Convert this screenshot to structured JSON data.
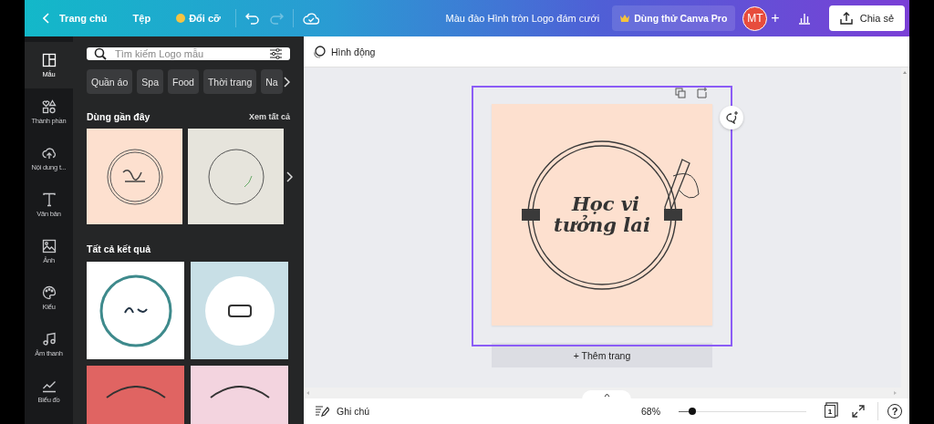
{
  "topbar": {
    "back": "Trang chủ",
    "file": "Tệp",
    "resize": "Đổi cỡ",
    "redo_disabled": true,
    "title": "Màu đào Hình tròn Logo đám cưới",
    "pro": "Dùng thử Canva Pro",
    "avatar": "MT",
    "add": "+",
    "share": "Chia sẻ"
  },
  "rail": [
    {
      "label": "Mẫu",
      "selected": true
    },
    {
      "label": "Thành phần",
      "selected": false
    },
    {
      "label": "Nội dung t...",
      "selected": false
    },
    {
      "label": "Văn bản",
      "selected": false
    },
    {
      "label": "Ảnh",
      "selected": false
    },
    {
      "label": "Kiểu",
      "selected": false
    },
    {
      "label": "Âm thanh",
      "selected": false
    },
    {
      "label": "Biểu đồ",
      "selected": false
    }
  ],
  "panel": {
    "search": {
      "placeholder": "Tìm kiếm Logo mẫu"
    },
    "chips": [
      "Quần áo",
      "Spa",
      "Food",
      "Thời trang",
      "Na"
    ],
    "recent": {
      "title": "Dùng gần đây",
      "see_all": "Xem tất cả",
      "thumbnails": [
        {
          "color": "#fde0cf"
        },
        {
          "color": "#e6e4dc"
        }
      ]
    },
    "results": {
      "title": "Tất cả kết quả",
      "thumbnails": [
        {
          "color": "#ffffff"
        },
        {
          "color": "#c8dfe6"
        },
        {
          "color": "#e06462"
        },
        {
          "color": "#f3d4df"
        }
      ]
    }
  },
  "toolbar": {
    "animate": "Hình động"
  },
  "design": {
    "lines": [
      "Học vi",
      "tưởng lai"
    ],
    "add_page": "+ Thêm trang"
  },
  "bottombar": {
    "notes": "Ghi chú",
    "zoom": "68%",
    "zoom_slider": {
      "level": 0.11
    },
    "page_count": "1",
    "help": "?"
  }
}
